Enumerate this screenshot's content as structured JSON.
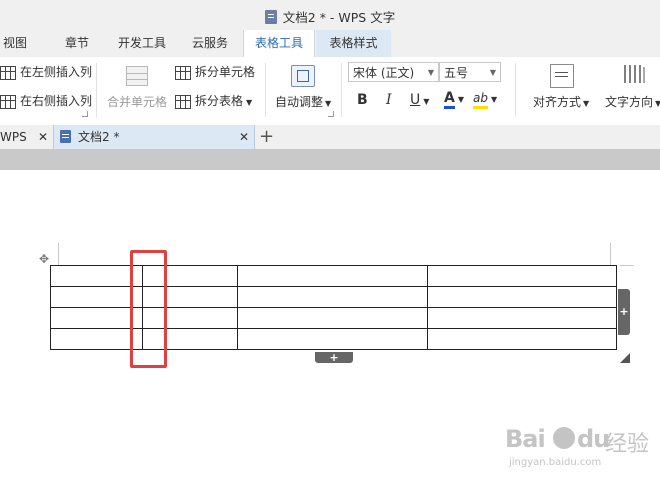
{
  "window": {
    "title": "文档2 * - WPS 文字"
  },
  "menu": {
    "items": [
      {
        "label": "视图"
      },
      {
        "label": "章节"
      },
      {
        "label": "开发工具"
      },
      {
        "label": "云服务"
      },
      {
        "label": "表格工具"
      },
      {
        "label": "表格样式"
      }
    ],
    "active": "表格工具"
  },
  "ribbon": {
    "insert_left": "在左侧插入列",
    "insert_right": "在右侧插入列",
    "merge_cells": "合并单元格",
    "split_cells": "拆分单元格",
    "split_table": "拆分表格",
    "auto_fit": "自动调整",
    "font_name": "宋体 (正文)",
    "font_size": "五号",
    "bold": "B",
    "italic": "I",
    "underline": "U",
    "font_color": "A",
    "highlight": "ab",
    "align": "对齐方式",
    "text_direction": "文字方向",
    "accent_color": "#2b6cb8",
    "font_color_value": "#1a4fd6",
    "highlight_color_value": "#f5e400"
  },
  "tabs": [
    {
      "label": "WPS"
    },
    {
      "label": "文档2 *"
    }
  ],
  "table": {
    "rows": 4,
    "highlighted_column": 2
  },
  "watermark": {
    "brand_a": "Bai",
    "brand_b": "du",
    "suffix": "经验",
    "url": "jingyan.baidu.com"
  },
  "icons": {
    "move": "move-icon",
    "add_column": "add-column-icon",
    "add_row": "add-row-icon",
    "resize": "resize-icon"
  }
}
